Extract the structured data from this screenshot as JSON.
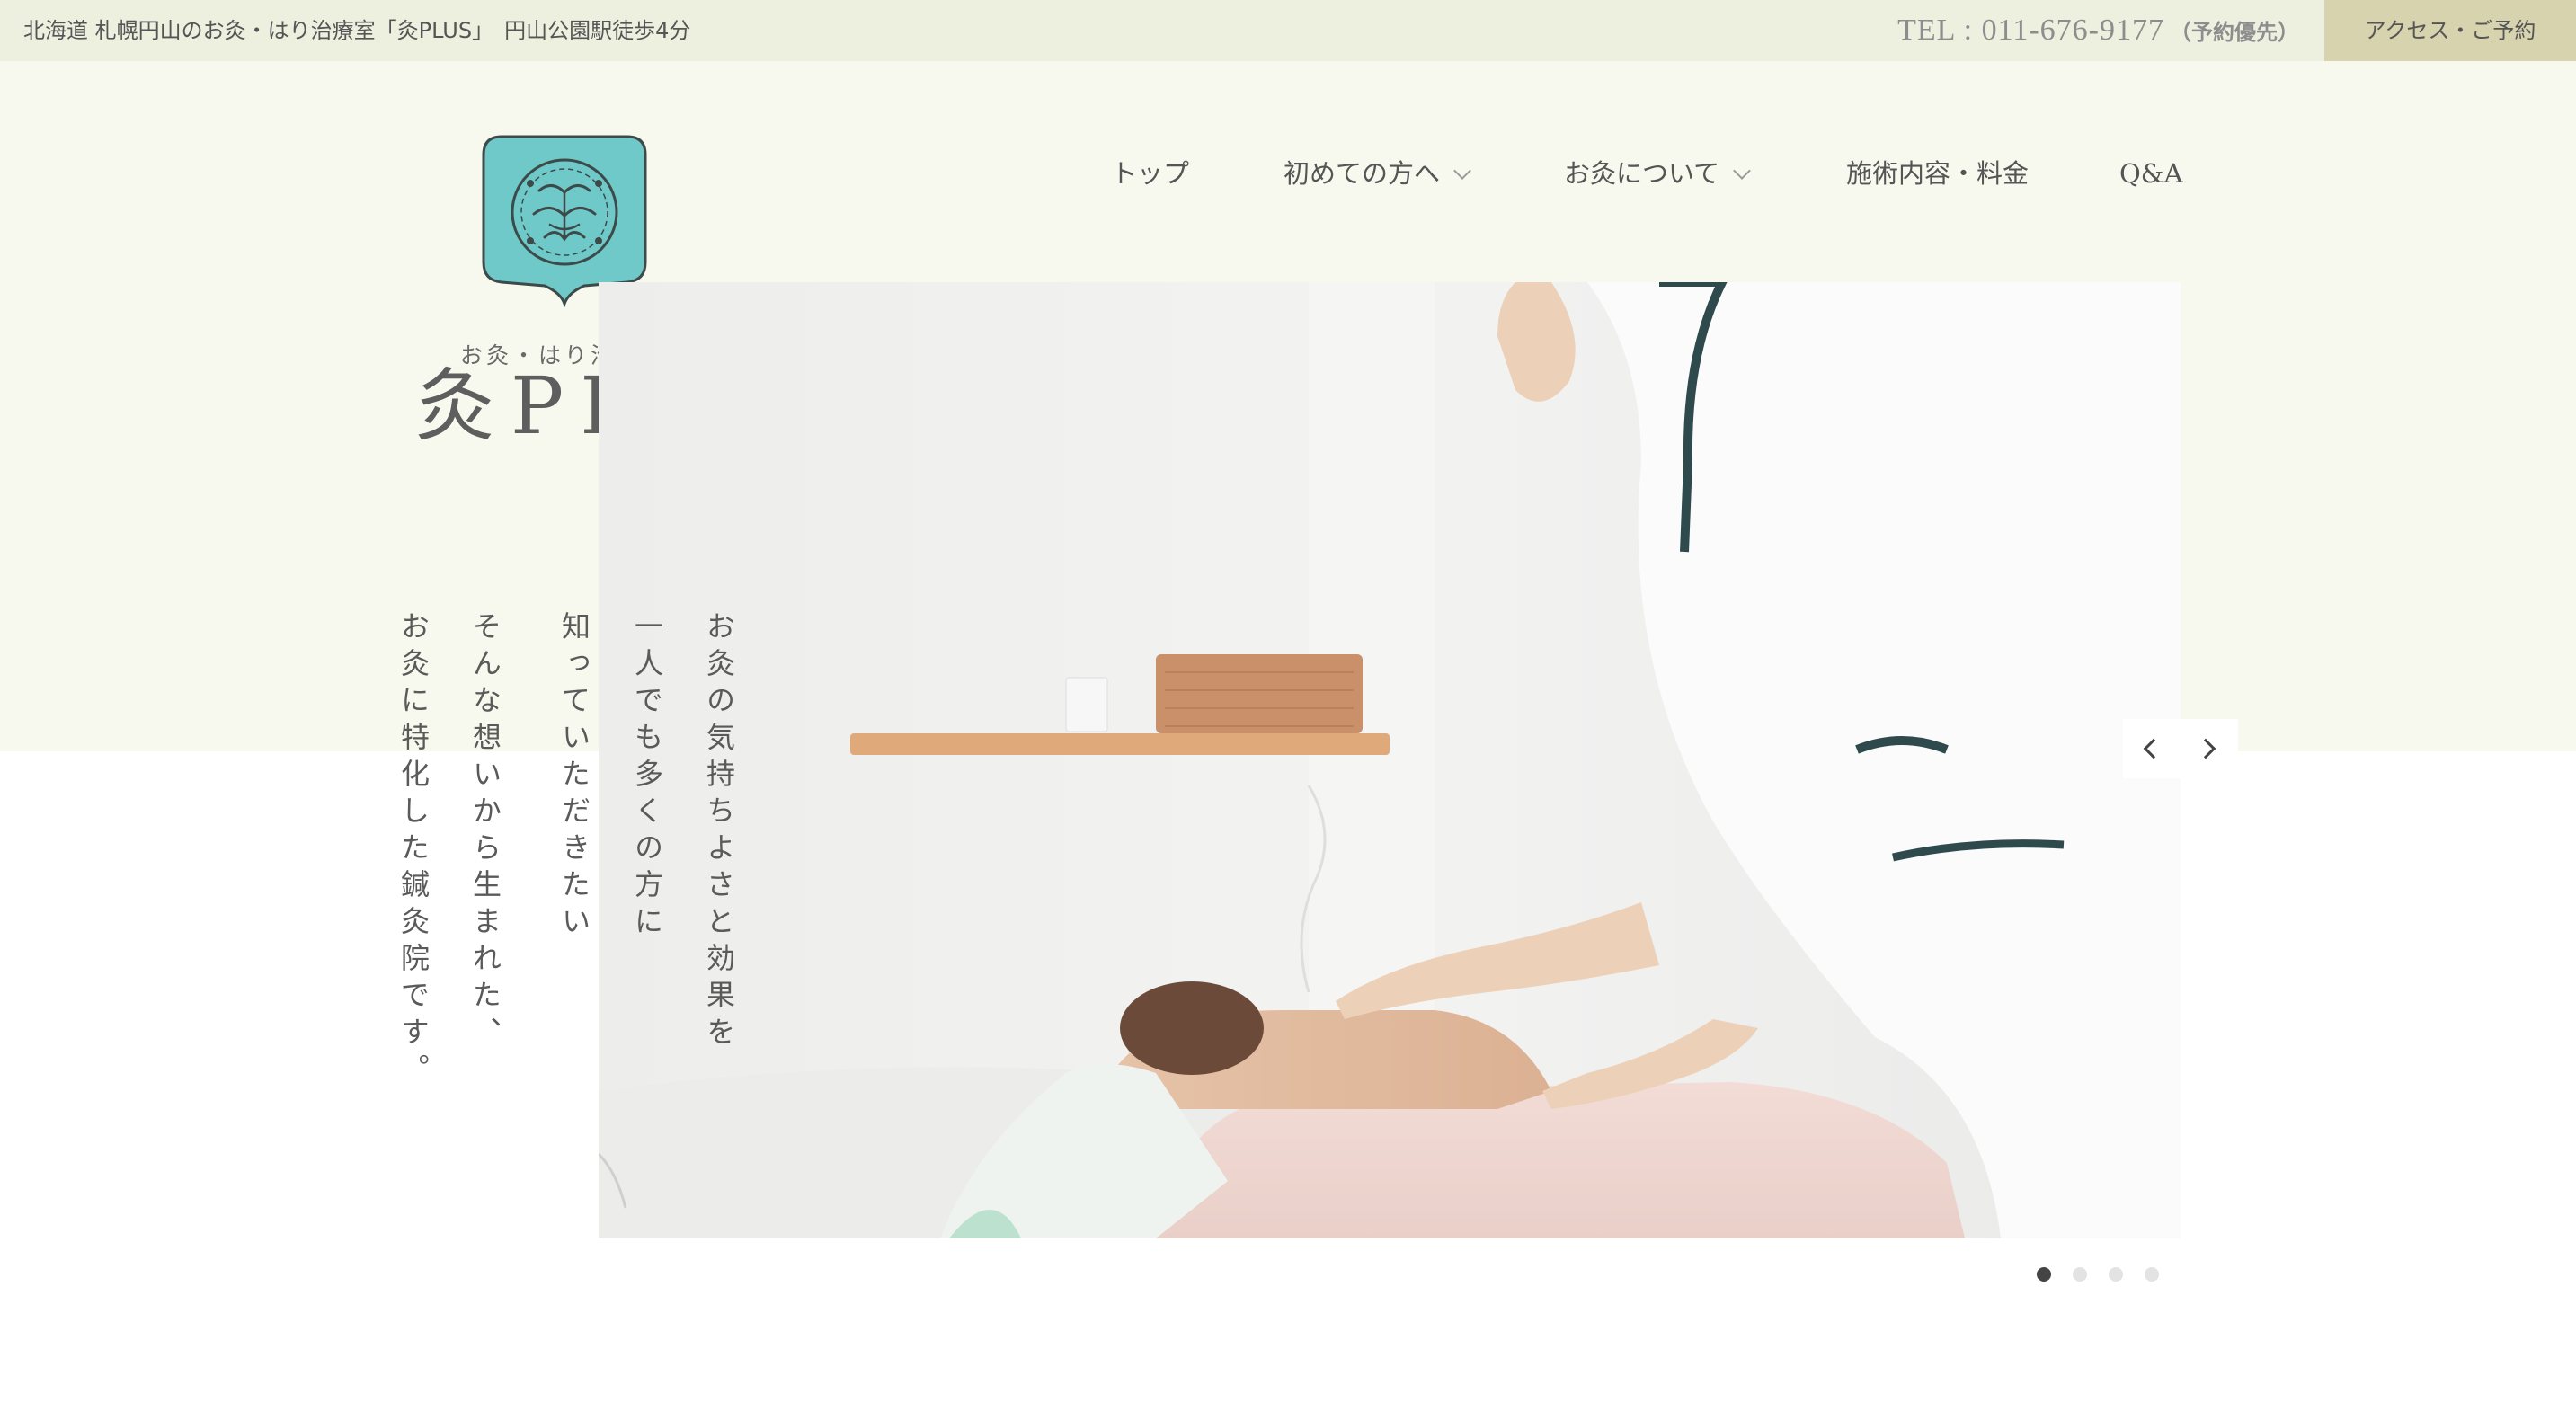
{
  "topbar": {
    "info": "北海道 札幌円山のお灸・はり治療室「灸PLUS」　円山公園駅徒歩4分",
    "tel": "TEL : 011-676-9177",
    "tel_note": "（予約優先）",
    "access_button": "アクセス・ご予約"
  },
  "logo": {
    "subtitle": "お灸・はり治療室",
    "title": "灸PLUS"
  },
  "nav": {
    "items": [
      {
        "label": "トップ",
        "has_dropdown": false
      },
      {
        "label": "初めての方へ",
        "has_dropdown": true
      },
      {
        "label": "お灸について",
        "has_dropdown": true
      },
      {
        "label": "施術内容・料金",
        "has_dropdown": false
      },
      {
        "label": "Q&A",
        "has_dropdown": false
      }
    ]
  },
  "hero": {
    "copy_lines": [
      "お灸の気持ちよさと効果を",
      "一人でも多くの方に",
      "知っていただきたい",
      "そんな想いから生まれた、",
      "お灸に特化した鍼灸院です。"
    ],
    "slide_count": 4,
    "active_slide": 1,
    "image_icon": "moxibustion-treatment-photo"
  },
  "colors": {
    "topbar_bg": "#eef0df",
    "header_bg": "#f8f9ee",
    "access_bg": "#d7d3ae",
    "logo_teal": "#6fc9c8"
  }
}
